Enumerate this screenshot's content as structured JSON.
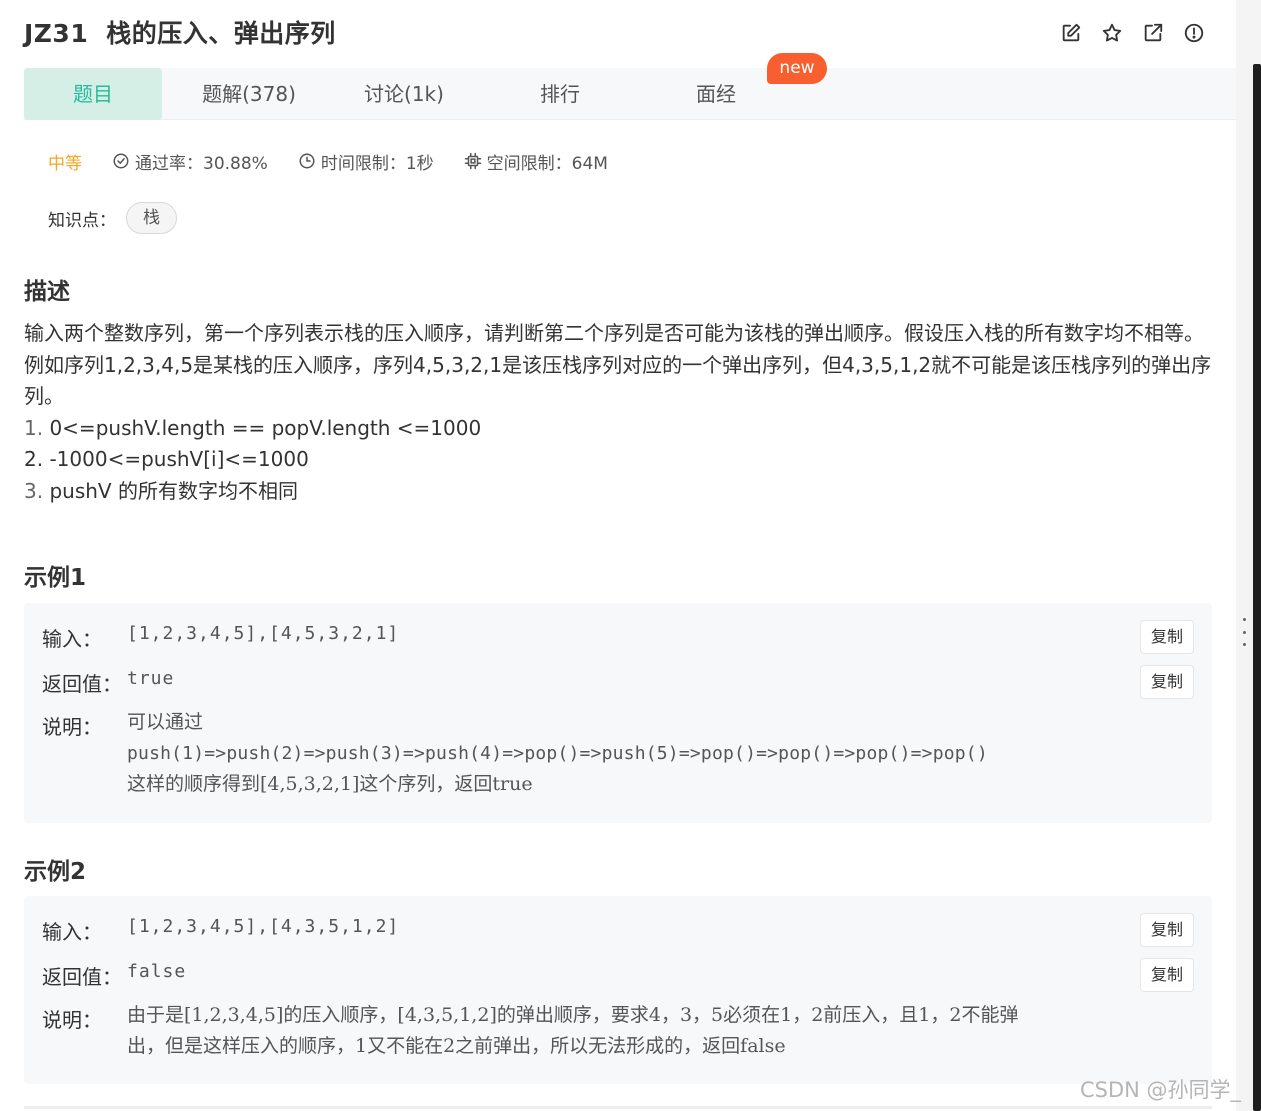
{
  "header": {
    "code": "JZ31",
    "title": "栈的压入、弹出序列",
    "icons": [
      "edit-icon",
      "star-icon",
      "external-link-icon",
      "info-icon"
    ]
  },
  "tabs": [
    {
      "label": "题目",
      "active": true
    },
    {
      "label": "题解(378)"
    },
    {
      "label": "讨论(1k)"
    },
    {
      "label": "排行"
    },
    {
      "label": "面经"
    }
  ],
  "badge_new": "new",
  "meta": {
    "difficulty": "中等",
    "pass_rate": "通过率：30.88%",
    "time_limit": "时间限制：1秒",
    "memory_limit": "空间限制：64M"
  },
  "knowledge": {
    "label": "知识点：",
    "tag": "栈"
  },
  "description": {
    "heading": "描述",
    "paragraph": "输入两个整数序列，第一个序列表示栈的压入顺序，请判断第二个序列是否可能为该栈的弹出顺序。假设压入栈的所有数字均不相等。例如序列1,2,3,4,5是某栈的压入顺序，序列4,5,3,2,1是该压栈序列对应的一个弹出序列，但4,3,5,1,2就不可能是该压栈序列的弹出序列。",
    "list": [
      {
        "num": "1.",
        "text": " 0<=pushV.length == popV.length <=1000"
      },
      {
        "num": "2.",
        "text": " -1000<=pushV[i]<=1000"
      },
      {
        "num": "3.",
        "text": " pushV 的所有数字均不相同"
      }
    ]
  },
  "example1": {
    "heading": "示例1",
    "input_label": "输入：",
    "input": "[1,2,3,4,5],[4,5,3,2,1]",
    "return_label": "返回值：",
    "return": "true",
    "explain_label": "说明：",
    "explain_line1": "可以通过",
    "explain_line2": "push(1)=>push(2)=>push(3)=>push(4)=>pop()=>push(5)=>pop()=>pop()=>pop()=>pop()",
    "explain_line3": "这样的顺序得到[4,5,3,2,1]这个序列，返回true",
    "copy": "复制"
  },
  "example2": {
    "heading": "示例2",
    "input_label": "输入：",
    "input": "[1,2,3,4,5],[4,3,5,1,2]",
    "return_label": "返回值：",
    "return": "false",
    "explain_label": "说明：",
    "explain_line1": "由于是[1,2,3,4,5]的压入顺序，[4,3,5,1,2]的弹出顺序，要求4，3，5必须在1，2前压入，且1，2不能弹",
    "explain_line2": "出，但是这样压入的顺序，1又不能在2之前弹出，所以无法形成的，返回false",
    "copy": "复制"
  },
  "watermark": "CSDN @孙同学_"
}
